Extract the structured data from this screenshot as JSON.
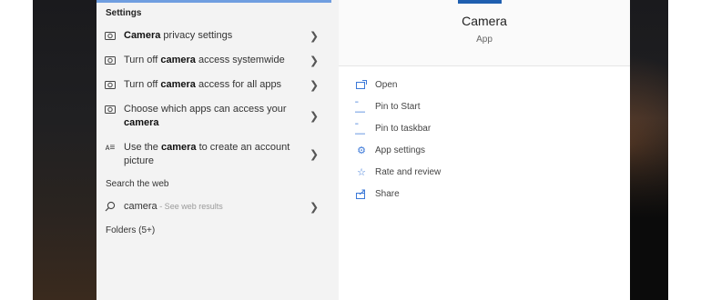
{
  "left": {
    "settings_header": "Settings",
    "settings_items": [
      {
        "pre": "",
        "bold": "Camera",
        "post": " privacy settings",
        "icon": "camera-settings-icon"
      },
      {
        "pre": "Turn off ",
        "bold": "camera",
        "post": " access systemwide",
        "icon": "camera-settings-icon"
      },
      {
        "pre": "Turn off ",
        "bold": "camera",
        "post": " access for all apps",
        "icon": "camera-settings-icon"
      },
      {
        "pre": "Choose which apps can access your ",
        "bold": "camera",
        "post": "",
        "icon": "camera-settings-icon"
      },
      {
        "pre": "Use the ",
        "bold": "camera",
        "post": " to create an account picture",
        "icon": "account-picture-icon"
      }
    ],
    "web_header": "Search the web",
    "web_item": {
      "query": "camera",
      "sub": " - See web results",
      "icon": "search-icon"
    },
    "folders_header": "Folders (5+)"
  },
  "right": {
    "app_name": "Camera",
    "app_type": "App",
    "actions": [
      {
        "label": "Open",
        "icon": "open-icon"
      },
      {
        "label": "Pin to Start",
        "icon": "pin-icon"
      },
      {
        "label": "Pin to taskbar",
        "icon": "pin-icon"
      },
      {
        "label": "App settings",
        "icon": "gear-icon"
      },
      {
        "label": "Rate and review",
        "icon": "star-icon"
      },
      {
        "label": "Share",
        "icon": "share-icon"
      }
    ]
  },
  "colors": {
    "accent": "#3b78d8",
    "tile": "#1f5fb0"
  }
}
